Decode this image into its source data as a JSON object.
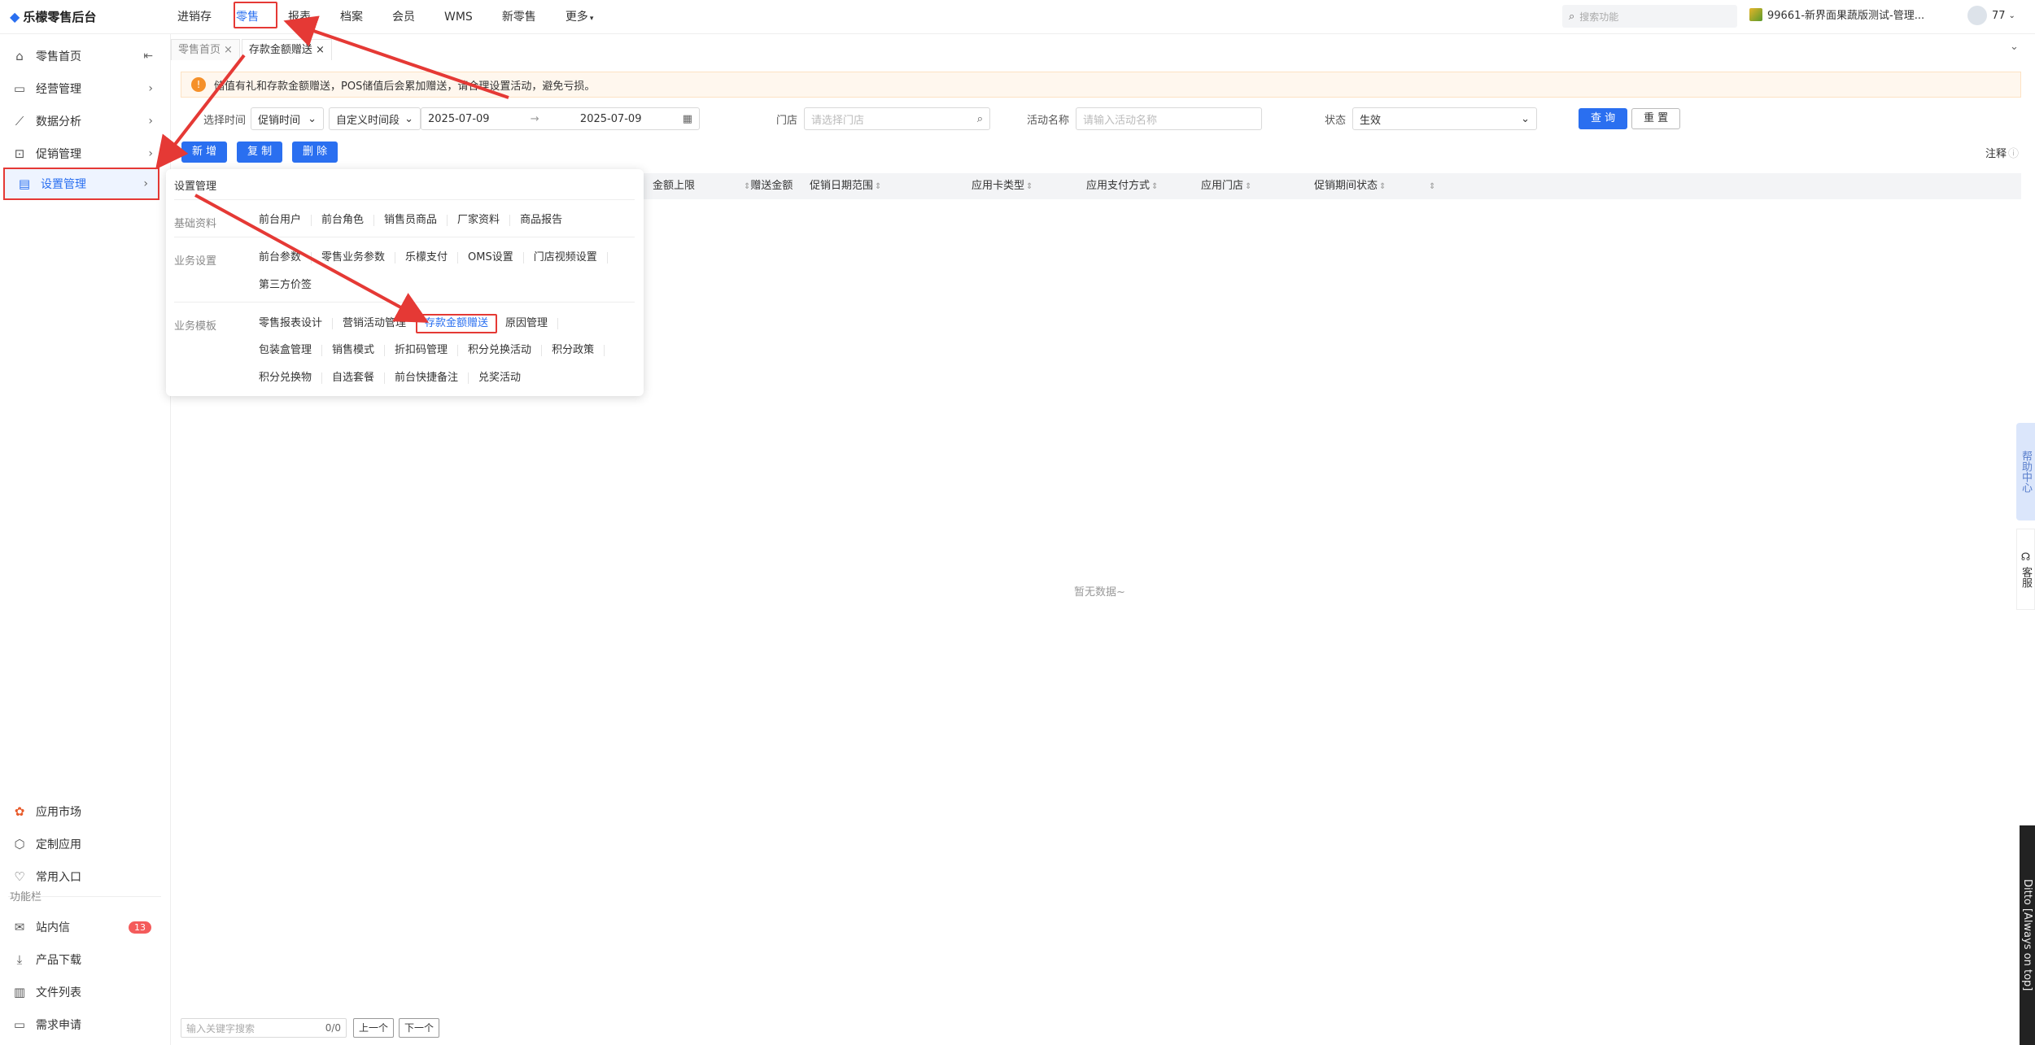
{
  "brand": {
    "logo_text": "乐檬零售后台"
  },
  "nav": {
    "items": [
      "进销存",
      "零售",
      "报表",
      "档案",
      "会员",
      "WMS",
      "新零售",
      "更多"
    ],
    "active": "零售"
  },
  "top": {
    "search_placeholder": "搜索功能",
    "shop": "99661-新界面果蔬版测试-管理...",
    "user": "77"
  },
  "sidebar": {
    "items": [
      {
        "label": "零售首页",
        "icon": "home-icon"
      },
      {
        "label": "经营管理",
        "icon": "monitor-icon"
      },
      {
        "label": "数据分析",
        "icon": "chart-icon"
      },
      {
        "label": "促销管理",
        "icon": "tag-icon"
      },
      {
        "label": "设置管理",
        "icon": "folder-icon"
      }
    ],
    "bottom_items": [
      {
        "label": "应用市场",
        "icon": "app-market-icon"
      },
      {
        "label": "定制应用",
        "icon": "custom-app-icon"
      },
      {
        "label": "常用入口",
        "icon": "heart-icon"
      }
    ],
    "section_label": "功能栏",
    "func_items": [
      {
        "label": "站内信",
        "icon": "mail-icon",
        "badge": "13"
      },
      {
        "label": "产品下载",
        "icon": "download-icon"
      },
      {
        "label": "文件列表",
        "icon": "file-icon"
      },
      {
        "label": "需求申请",
        "icon": "request-icon"
      }
    ]
  },
  "tabs": [
    {
      "label": "零售首页",
      "active": false
    },
    {
      "label": "存款金额赠送",
      "active": true
    }
  ],
  "notice": {
    "text": "储值有礼和存款金额赠送，POS储值后会累加赠送，请合理设置活动，避免亏损。"
  },
  "filters": {
    "time_label": "选择时间",
    "time_type": "促销时间",
    "time_range_type": "自定义时间段",
    "date_start": "2025-07-09",
    "date_sep": "→",
    "date_end": "2025-07-09",
    "store_label": "门店",
    "store_placeholder": "请选择门店",
    "activity_label": "活动名称",
    "activity_placeholder": "请输入活动名称",
    "status_label": "状态",
    "status_value": "生效",
    "query": "查 询",
    "reset": "重 置"
  },
  "actions": {
    "add": "新 增",
    "copy": "复 制",
    "delete": "删 除"
  },
  "note_label": "注释",
  "table": {
    "columns": [
      "金额上限",
      "赠送金额",
      "促销日期范围",
      "应用卡类型",
      "应用支付方式",
      "应用门店",
      "促销期间状态"
    ],
    "empty": "暂无数据~"
  },
  "dropdown": {
    "title": "设置管理",
    "sections": [
      {
        "label": "基础资料",
        "rows": [
          [
            "前台用户",
            "前台角色",
            "销售员商品",
            "厂家资料",
            "商品报告"
          ]
        ]
      },
      {
        "label": "业务设置",
        "rows": [
          [
            "前台参数",
            "零售业务参数",
            "乐檬支付",
            "OMS设置",
            "门店视频设置"
          ],
          [
            "第三方价签"
          ]
        ]
      },
      {
        "label": "业务模板",
        "rows": [
          [
            "零售报表设计",
            "营销活动管理",
            "存款金额赠送",
            "原因管理"
          ],
          [
            "包装盒管理",
            "销售模式",
            "折扣码管理",
            "积分兑换活动",
            "积分政策"
          ],
          [
            "积分兑换物",
            "自选套餐",
            "前台快捷备注",
            "兑奖活动"
          ]
        ]
      }
    ],
    "highlighted": "存款金额赠送"
  },
  "bottom": {
    "search_placeholder": "输入关键字搜索",
    "count": "0/0",
    "prev": "上一个",
    "next": "下一个"
  },
  "side_widgets": {
    "help": "帮助中心",
    "service": "客服"
  },
  "ditto": "Ditto [Always on top]",
  "colors": {
    "accent": "#2a6ff0",
    "annotation": "#e53935",
    "notice_icon": "#f5902a"
  }
}
